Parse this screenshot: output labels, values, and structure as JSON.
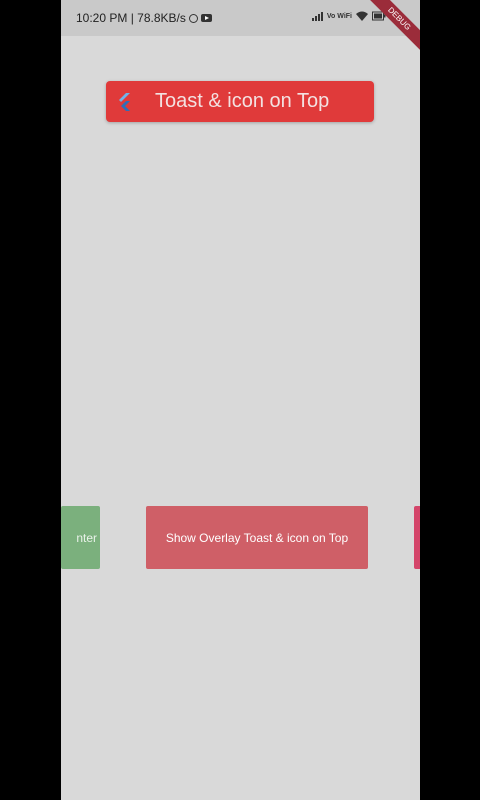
{
  "status_bar": {
    "time_text": "10:20 PM | 78.8KB/s",
    "network_label": "Vo WiFi",
    "icons": [
      "whatsapp-icon",
      "youtube-icon",
      "signal-icon",
      "wifi-icon",
      "battery-icon"
    ]
  },
  "debug_banner": "DEBUG",
  "toast": {
    "text": "Toast & icon on Top",
    "icon": "flutter-icon",
    "color": "#e03a3a"
  },
  "buttons": {
    "left_partial_label": "nter",
    "center_label": "Show Overlay Toast & icon on Top",
    "colors": {
      "left": "#7bb07d",
      "center": "#cf5f67",
      "right": "#d4456a"
    }
  }
}
